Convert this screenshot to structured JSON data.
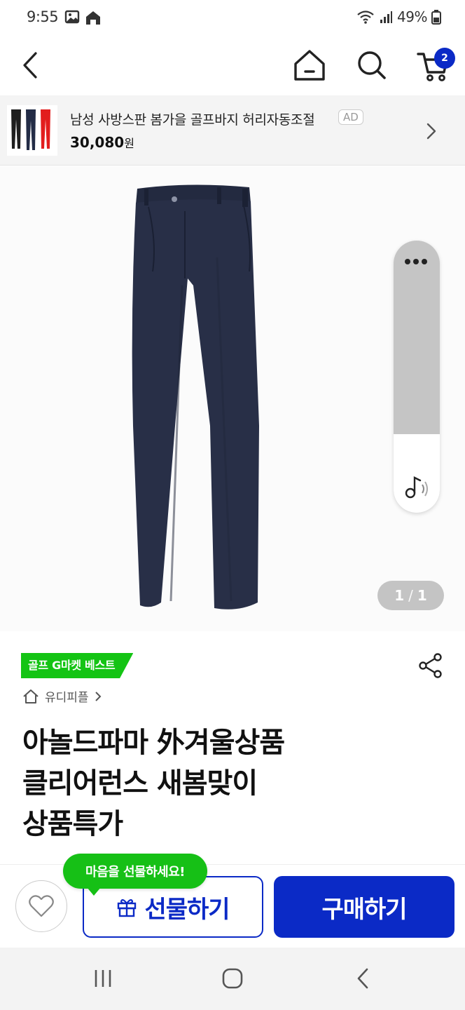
{
  "status_bar": {
    "time": "9:55",
    "battery": "49%"
  },
  "top_nav": {
    "cart_count": "2"
  },
  "ad": {
    "title": "남성 사방스판 봄가을 골프바지 허리자동조절",
    "tag": "AD",
    "price": "30,080",
    "price_unit": "원"
  },
  "gallery": {
    "current": "1",
    "separator": "/",
    "total": "1"
  },
  "product": {
    "best_badge": "골프 G마켓 베스트",
    "shop_name": "유디피플",
    "title_lines": [
      "아놀드파마 外겨울상품",
      "클리어런스  새봄맞이",
      "상품특가"
    ]
  },
  "actions": {
    "gift_tooltip": "마음을 선물하세요!",
    "gift_label": "선물하기",
    "buy_label": "구매하기"
  },
  "colors": {
    "brand_blue": "#0b2ac6",
    "badge_green": "#14c414"
  }
}
